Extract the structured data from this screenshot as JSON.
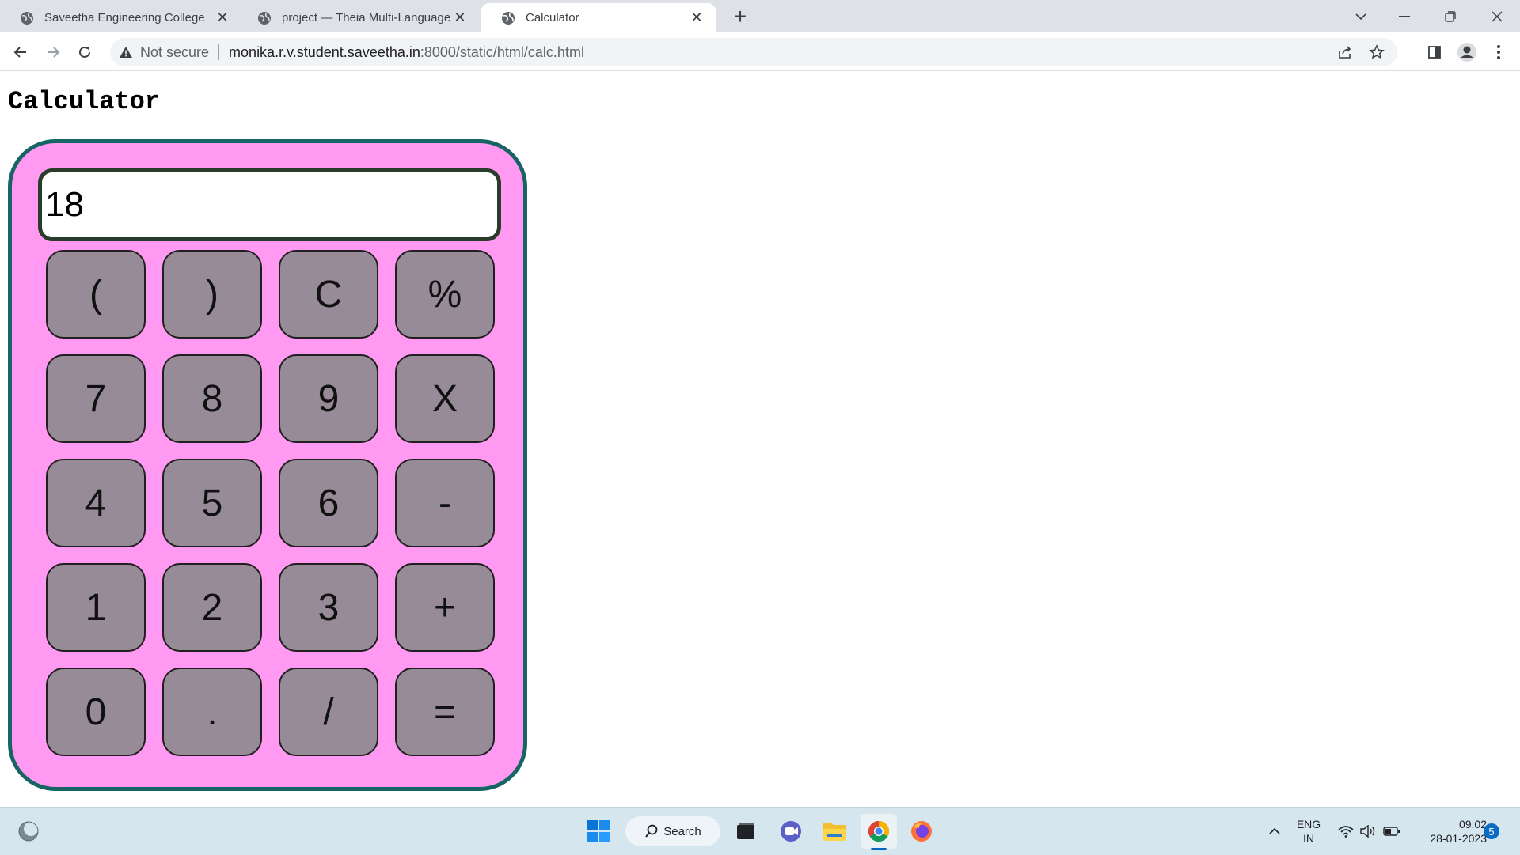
{
  "browser": {
    "tabs": [
      {
        "title": "Saveetha Engineering College",
        "active": false
      },
      {
        "title": "project — Theia Multi-Language",
        "active": false
      },
      {
        "title": "Calculator",
        "active": true
      }
    ],
    "security_label": "Not secure",
    "url_host": "monika.r.v.student.saveetha.in",
    "url_path": ":8000/static/html/calc.html"
  },
  "page": {
    "title": "Calculator",
    "display_value": "18",
    "keys": [
      {
        "label": "(",
        "name": "open-paren"
      },
      {
        "label": ")",
        "name": "close-paren"
      },
      {
        "label": "C",
        "name": "clear"
      },
      {
        "label": "%",
        "name": "percent"
      },
      {
        "label": "7",
        "name": "7"
      },
      {
        "label": "8",
        "name": "8"
      },
      {
        "label": "9",
        "name": "9"
      },
      {
        "label": "X",
        "name": "multiply"
      },
      {
        "label": "4",
        "name": "4"
      },
      {
        "label": "5",
        "name": "5"
      },
      {
        "label": "6",
        "name": "6"
      },
      {
        "label": "-",
        "name": "minus"
      },
      {
        "label": "1",
        "name": "1"
      },
      {
        "label": "2",
        "name": "2"
      },
      {
        "label": "3",
        "name": "3"
      },
      {
        "label": "+",
        "name": "plus"
      },
      {
        "label": "0",
        "name": "0"
      },
      {
        "label": ".",
        "name": "decimal"
      },
      {
        "label": "/",
        "name": "divide"
      },
      {
        "label": "=",
        "name": "equals"
      }
    ],
    "colors": {
      "calc_body": "#ff99f2",
      "calc_border": "#176464",
      "key_fill": "#978b97"
    }
  },
  "taskbar": {
    "search_label": "Search",
    "lang_top": "ENG",
    "lang_bottom": "IN",
    "time": "09:02",
    "date": "28-01-2023",
    "notification_count": "5"
  }
}
